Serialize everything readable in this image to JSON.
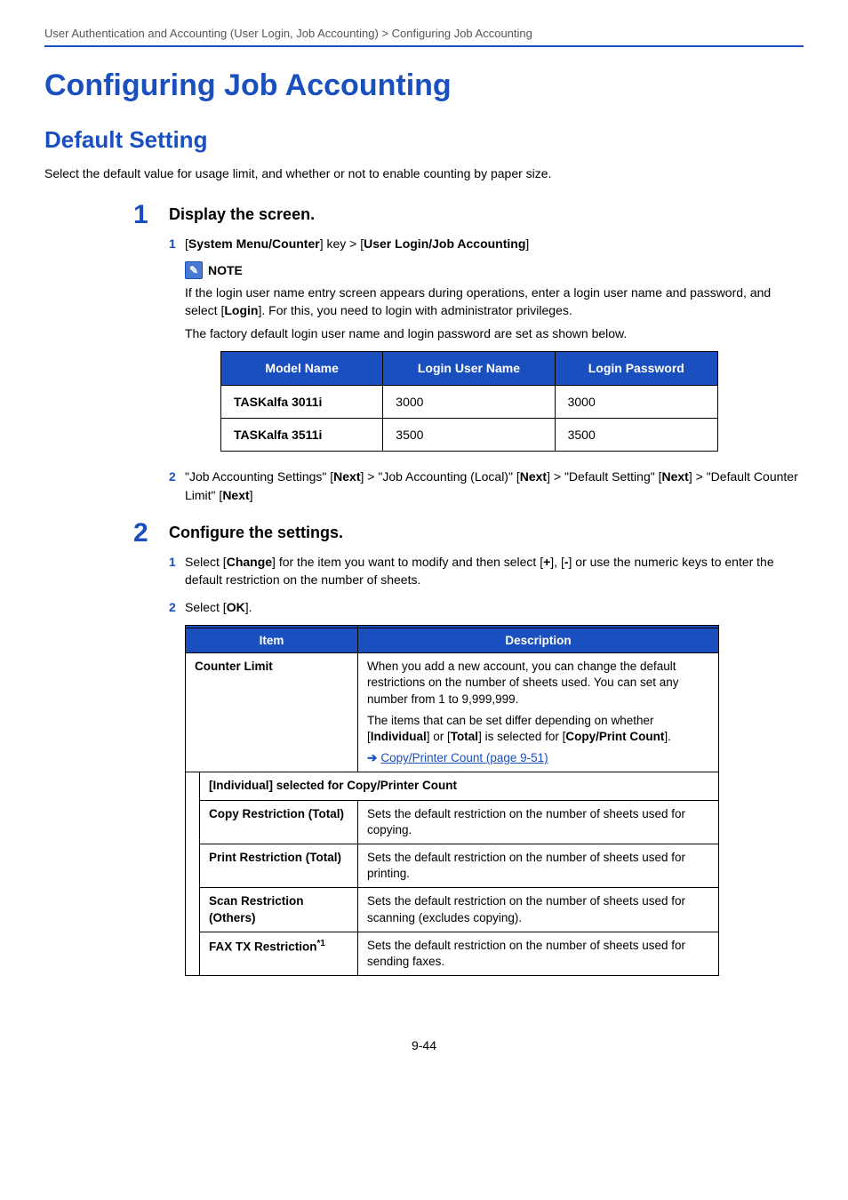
{
  "breadcrumb": "User Authentication and Accounting (User Login, Job Accounting) > Configuring Job Accounting",
  "h1": "Configuring Job Accounting",
  "h2": "Default Setting",
  "intro": "Select the default value for usage limit, and whether or not to enable counting by paper size.",
  "step1": {
    "num": "1",
    "title": "Display the screen.",
    "item1_num": "1",
    "item1_open": "[",
    "item1_bold1": "System Menu/Counter",
    "item1_mid": "] key > [",
    "item1_bold2": "User Login/Job Accounting",
    "item1_close": "]",
    "note_label": "NOTE",
    "note_p1_before": "If the login user name entry screen appears during operations, enter a login user name and password, and select [",
    "note_p1_bold": "Login",
    "note_p1_after": "]. For this, you need to login with administrator privileges.",
    "note_p2": "The factory default login user name and login password are set as shown below.",
    "login_table": {
      "headers": [
        "Model Name",
        "Login User Name",
        "Login Password"
      ],
      "rows": [
        [
          "TASKalfa 3011i",
          "3000",
          "3000"
        ],
        [
          "TASKalfa 3511i",
          "3500",
          "3500"
        ]
      ]
    },
    "item2_num": "2",
    "item2_a": "\"Job Accounting Settings\" [",
    "item2_b1": "Next",
    "item2_b": "] > \"Job Accounting (Local)\" [",
    "item2_b2": "Next",
    "item2_c": "] > \"Default Setting\" [",
    "item2_b3": "Next",
    "item2_d": "] > \"Default Counter Limit\" [",
    "item2_b4": "Next",
    "item2_e": "]"
  },
  "step2": {
    "num": "2",
    "title": "Configure the settings.",
    "item1_num": "1",
    "item1_a": "Select [",
    "item1_b1": "Change",
    "item1_b": "] for the item you want to modify and then select [",
    "item1_b2": "+",
    "item1_c": "], [",
    "item1_b3": "-",
    "item1_d": "] or use the numeric keys to enter the default restriction on the number of sheets.",
    "item2_num": "2",
    "item2_a": "Select [",
    "item2_b1": "OK",
    "item2_b": "]."
  },
  "desc_table": {
    "head_item": "Item",
    "head_desc": "Description",
    "counter_limit_label": "Counter Limit",
    "counter_limit_desc_a": "When you add a new account, you can change the default restrictions on the number of sheets used. You can set any number from 1 to 9,999,999.",
    "counter_limit_desc_b1": "The items that can be set differ depending on whether [",
    "counter_limit_desc_b2": "Individual",
    "counter_limit_desc_b3": "] or [",
    "counter_limit_desc_b4": "Total",
    "counter_limit_desc_b5": "] is selected for [",
    "counter_limit_desc_b6": "Copy/Print Count",
    "counter_limit_desc_b7": "].",
    "counter_limit_link": "Copy/Printer Count (page 9-51)",
    "subheader": "[Individual] selected for Copy/Printer Count",
    "rows": [
      {
        "item": "Copy Restriction (Total)",
        "desc": "Sets the default restriction on the number of sheets used for copying."
      },
      {
        "item": "Print Restriction (Total)",
        "desc": "Sets the default restriction on the number of sheets used for printing."
      },
      {
        "item": "Scan Restriction (Others)",
        "desc": "Sets the default restriction on the number of sheets used for scanning (excludes copying)."
      }
    ],
    "fax_item_prefix": "FAX TX Restriction",
    "fax_item_sup": "*1",
    "fax_desc": "Sets the default restriction on the number of sheets used for sending faxes."
  },
  "page_number": "9-44"
}
